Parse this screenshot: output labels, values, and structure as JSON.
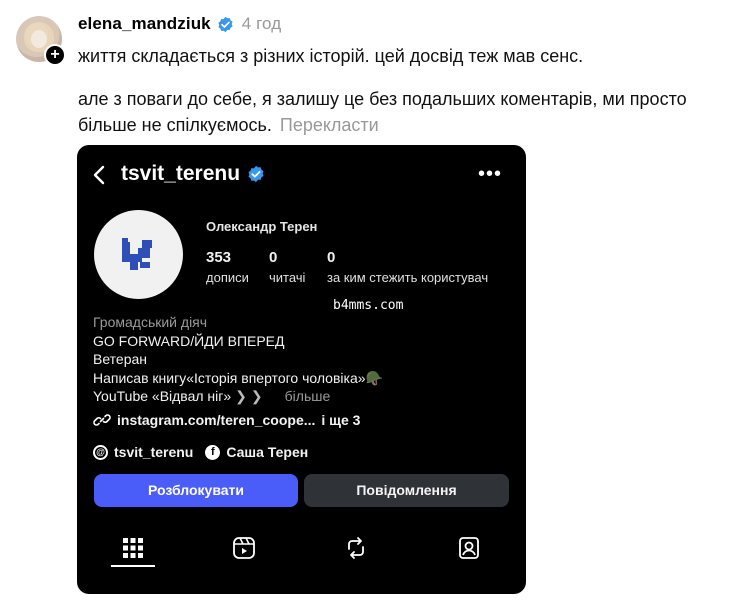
{
  "comment": {
    "username": "elena_mandziuk",
    "time": "4 год",
    "line1": "життя складається з різних історій. цей досвід теж мав сенс.",
    "line2": "але з поваги до себе, я залишу це без подальших коментарів, ми просто більше не спілкуємось.",
    "translate": "Перекласти"
  },
  "profile": {
    "handle": "tsvit_terenu",
    "full_name": "Олександр Терен",
    "stats": [
      {
        "num": "353",
        "label": "дописи"
      },
      {
        "num": "0",
        "label": "читачі"
      },
      {
        "num": "0",
        "label": "за ким стежить користувач"
      }
    ],
    "category": "Громадський діяч",
    "bio": [
      "GO FORWARD/ЙДИ ВПЕРЕД",
      "Ветеран",
      "Написав книгу«Історія впертого чоловіка»🪖",
      "YouTube «Відвал ніг»"
    ],
    "bio_more": "більше",
    "link": "instagram.com/teren_coope...",
    "link_more": "і ще 3",
    "threads": "tsvit_terenu",
    "facebook": "Саша Терен",
    "unblock_label": "Розблокувати",
    "message_label": "Повідомлення"
  },
  "watermark": "b4mms.com",
  "colors": {
    "accent": "#4a5df9",
    "verified": "#3897f0",
    "muted": "#999999"
  }
}
